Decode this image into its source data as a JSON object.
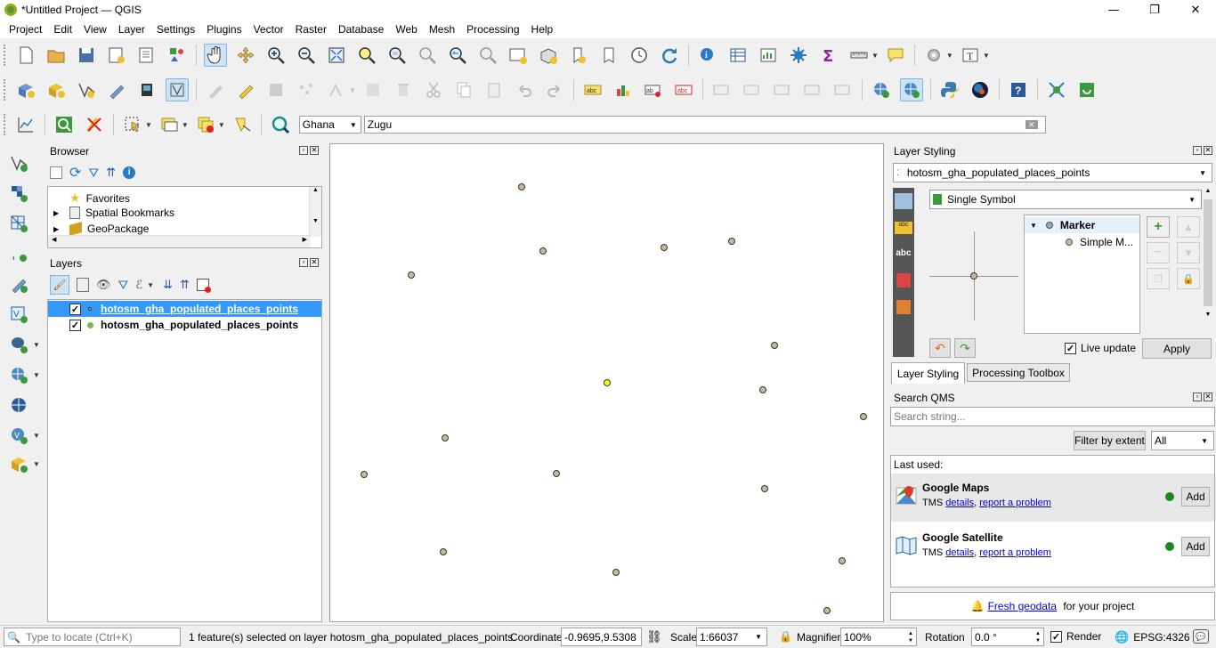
{
  "window": {
    "title": "*Untitled Project — QGIS"
  },
  "menu": [
    "Project",
    "Edit",
    "View",
    "Layer",
    "Settings",
    "Plugins",
    "Vector",
    "Raster",
    "Database",
    "Web",
    "Mesh",
    "Processing",
    "Help"
  ],
  "locator_bar": {
    "country": "Ghana",
    "search_value": "Zugu"
  },
  "browser": {
    "title": "Browser",
    "items": [
      {
        "label": "Favorites"
      },
      {
        "label": "Spatial Bookmarks"
      },
      {
        "label": "GeoPackage"
      }
    ]
  },
  "layers": {
    "title": "Layers",
    "items": [
      {
        "label": "hotosm_gha_populated_places_points",
        "checked": true,
        "selected": true
      },
      {
        "label": "hotosm_gha_populated_places_points",
        "checked": true,
        "selected": false
      }
    ]
  },
  "layer_styling": {
    "title": "Layer Styling",
    "layer_name": "hotosm_gha_populated_places_points",
    "renderer": "Single Symbol",
    "tree": [
      {
        "label": "Marker"
      },
      {
        "label": "Simple M..."
      }
    ],
    "live_update_label": "Live update",
    "live_update_checked": true,
    "apply_label": "Apply",
    "tabs": [
      "Layer Styling",
      "Processing Toolbox"
    ]
  },
  "qms": {
    "title": "Search QMS",
    "search_placeholder": "Search string...",
    "filter_label": "Filter by extent",
    "filter_value": "All",
    "last_used_label": "Last used:",
    "services": [
      {
        "name": "Google Maps",
        "type": "TMS",
        "details": "details",
        "report": "report a problem",
        "add": "Add"
      },
      {
        "name": "Google Satellite",
        "type": "TMS",
        "details": "details",
        "report": "report a problem",
        "add": "Add"
      }
    ],
    "fresh_link": "Fresh geodata",
    "fresh_suffix": " for your project"
  },
  "status": {
    "locate_placeholder": "Type to locate (Ctrl+K)",
    "message": "1 feature(s) selected on layer hotosm_gha_populated_places_points.",
    "coordinate_label": "Coordinate",
    "coordinate_value": "-0.9695,9.5308",
    "scale_label": "Scale",
    "scale_value": "1:66037",
    "magnifier_label": "Magnifier",
    "magnifier_value": "100%",
    "rotation_label": "Rotation",
    "rotation_value": "0.0 °",
    "render_label": "Render",
    "crs": "EPSG:4326"
  },
  "colors": {
    "point_fill": "#c9b99b",
    "point_selected": "#ffff00",
    "selection_blue": "#3399ff",
    "qms_active": "#1a8a1a"
  }
}
